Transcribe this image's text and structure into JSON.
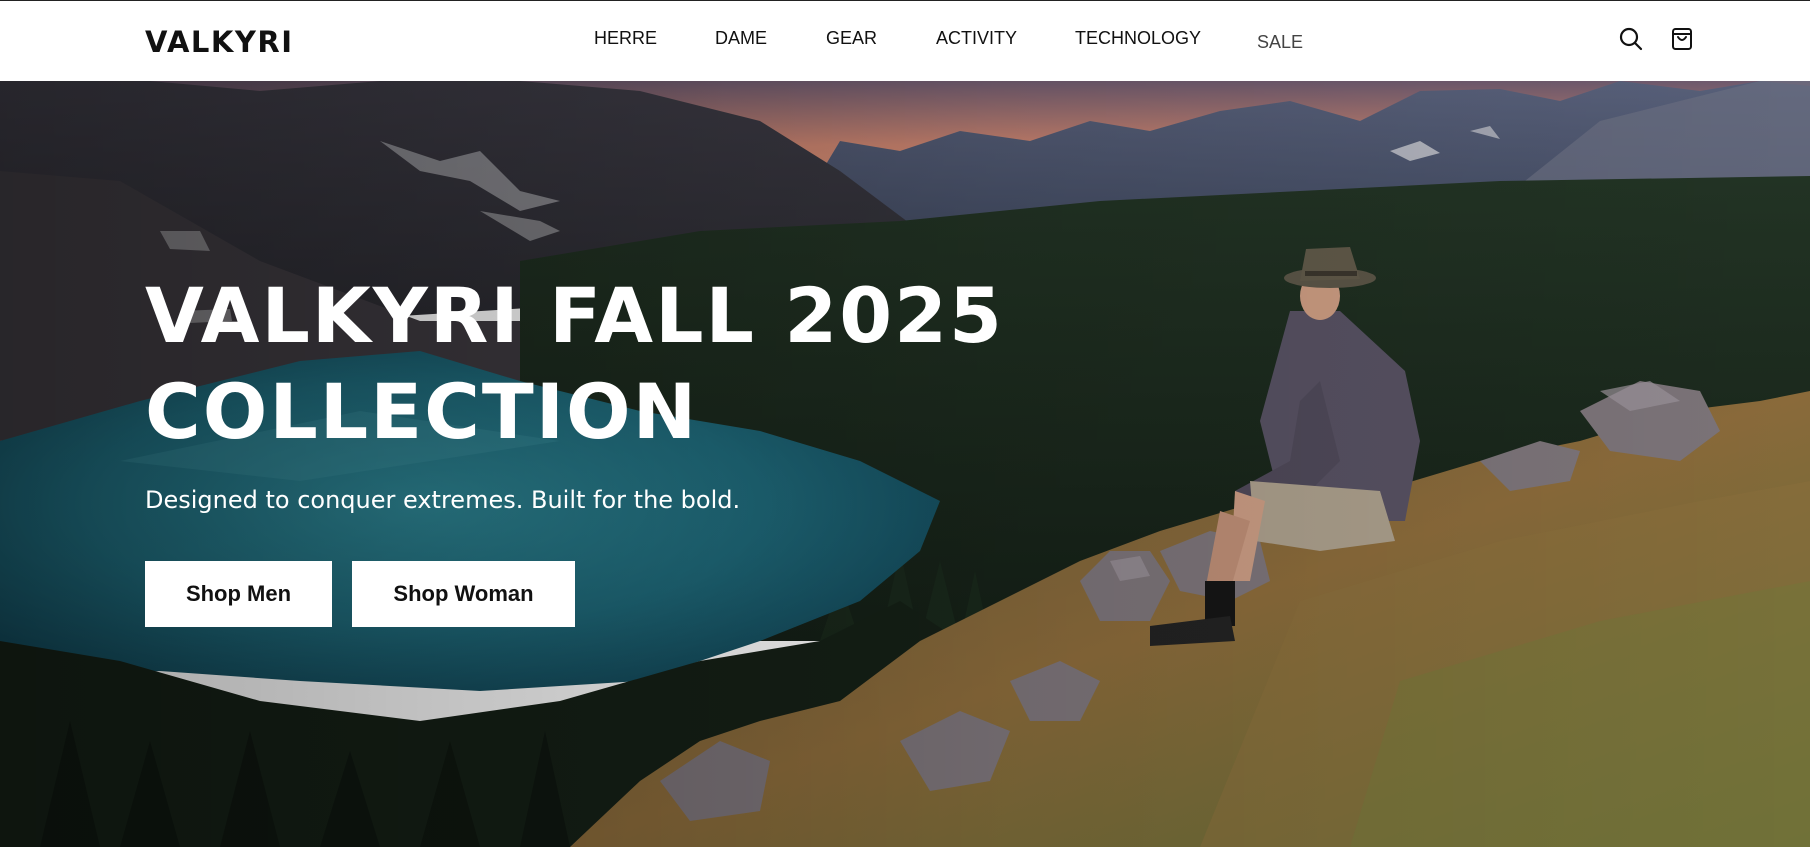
{
  "brand": {
    "logo_text": "VALKYRI"
  },
  "nav": {
    "items": [
      {
        "label": "HERRE"
      },
      {
        "label": "DAME"
      },
      {
        "label": "GEAR"
      },
      {
        "label": "ACTIVITY"
      },
      {
        "label": "TECHNOLOGY"
      },
      {
        "label": "SALE"
      }
    ]
  },
  "header_icons": {
    "search": "search-icon",
    "cart": "shopping-bag-icon"
  },
  "hero": {
    "title_line1": "VALKYRI FALL 2025",
    "title_line2": "COLLECTION",
    "subtitle": "Designed to conquer extremes. Built for the bold.",
    "buttons": {
      "men": "Shop Men",
      "women": "Shop Woman"
    }
  },
  "colors": {
    "header_bg": "#ffffff",
    "text_dark": "#111111",
    "hero_text": "#ffffff",
    "button_bg": "#ffffff",
    "sky_sunset": "#d98a6a",
    "lake": "#1f6f82",
    "forest": "#1b2a1e"
  }
}
